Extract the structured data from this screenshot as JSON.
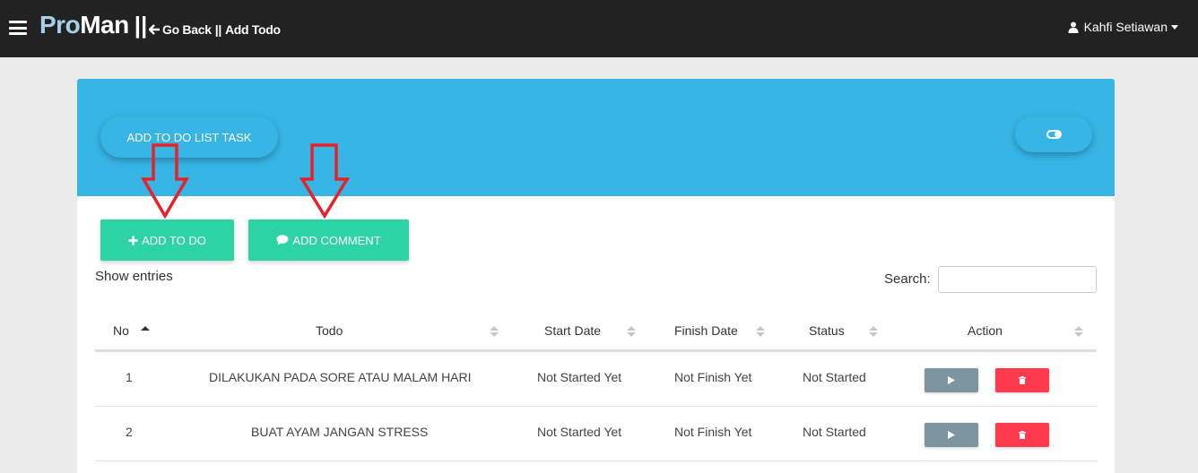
{
  "navbar": {
    "brand_pro": "Pro",
    "brand_man": "Man",
    "brand_sep": "||",
    "go_back": "Go Back",
    "crumb_sep": "||",
    "current_page": "Add Todo",
    "user_name": "Kahfi Setiawan"
  },
  "header": {
    "add_task_label": "ADD TO DO LIST TASK"
  },
  "actions": {
    "add_todo_label": "ADD TO DO",
    "add_comment_label": "ADD COMMENT"
  },
  "table_controls": {
    "show_entries": "Show entries",
    "search_label": "Search:",
    "search_value": ""
  },
  "table": {
    "columns": [
      "No",
      "Todo",
      "Start Date",
      "Finish Date",
      "Status",
      "Action"
    ],
    "rows": [
      {
        "no": "1",
        "todo": "DILAKUKAN PADA SORE ATAU MALAM HARI",
        "start": "Not Started Yet",
        "finish": "Not Finish Yet",
        "status": "Not Started"
      },
      {
        "no": "2",
        "todo": "BUAT AYAM JANGAN STRESS",
        "start": "Not Started Yet",
        "finish": "Not Finish Yet",
        "status": "Not Started"
      }
    ]
  },
  "colors": {
    "navbar_bg": "#222222",
    "header_blue": "#37b5e5",
    "action_green": "#2ed3a5",
    "play_gray": "#7d959f",
    "delete_red": "#ff3a4f",
    "annotation_red": "#e8202a"
  },
  "icons": {
    "menu": "hamburger-icon",
    "back": "arrow-left-icon",
    "user": "user-icon",
    "toggle": "toggle-icon",
    "add": "plus-icon",
    "comment": "comment-icon",
    "play": "play-icon",
    "delete": "trash-icon",
    "annotation": "down-arrow-annotation"
  }
}
